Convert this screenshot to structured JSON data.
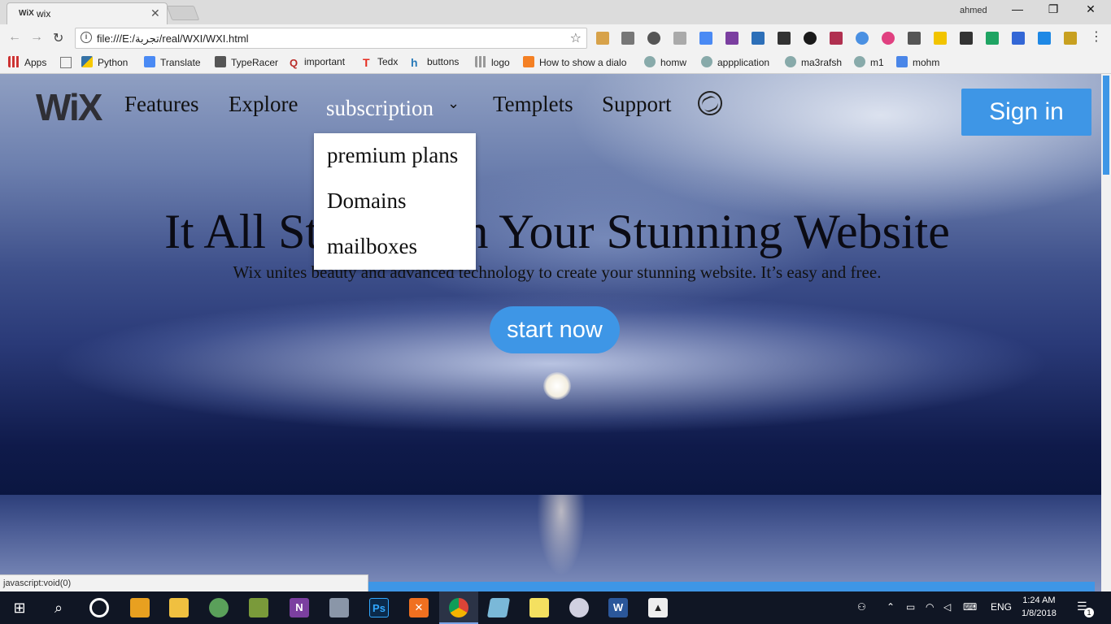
{
  "browser": {
    "tab": {
      "favicon": "WiX",
      "title": "wix",
      "close": "✕"
    },
    "user": "ahmed",
    "window_buttons": [
      "—",
      "❐",
      "✕"
    ],
    "url": "file:///E:/تجربة/real/WXI/WXI.html",
    "bookmarks": [
      "Apps",
      "Python",
      "Translate",
      "TypeRacer",
      "important",
      "Tedx",
      "buttons",
      "logo",
      "How to show a dialo",
      "homw",
      "appplication",
      "ma3rafsh",
      "m1",
      "mohm"
    ],
    "status_text": "javascript:void(0)"
  },
  "site": {
    "logo": "WiX",
    "nav": [
      "Features",
      "Explore",
      "subscription",
      "Templets",
      "Support"
    ],
    "signin_label": "Sign in",
    "dropdown": [
      "premium plans",
      "Domains",
      "mailboxes"
    ],
    "hero_title": "It All Starts with Your Stunning Website",
    "hero_subtitle": "Wix unites beauty and advanced technology to create your stunning website. It’s easy and free.",
    "cta_label": "start now",
    "accent_color": "#3e96e6"
  },
  "taskbar": {
    "language": "ENG",
    "time": "1:24 AM",
    "date": "1/8/2018",
    "notification_count": "1"
  }
}
